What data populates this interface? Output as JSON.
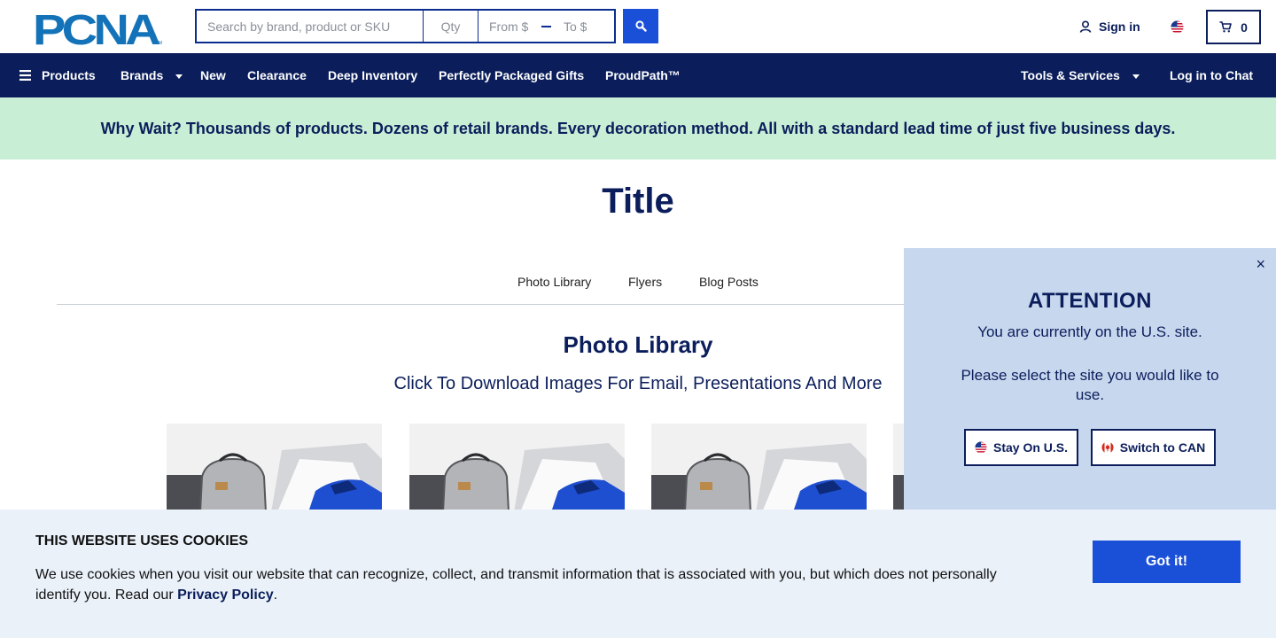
{
  "header": {
    "logo_text": "PCNA",
    "search": {
      "placeholder": "Search by brand, product or SKU",
      "value": ""
    },
    "qty": {
      "placeholder": "Qty",
      "value": ""
    },
    "price_from": {
      "placeholder": "From $",
      "value": ""
    },
    "price_to": {
      "placeholder": "To $",
      "value": ""
    },
    "signin_label": "Sign in",
    "cart_count": "0"
  },
  "nav": {
    "products": "Products",
    "brands": "Brands",
    "new": "New",
    "clearance": "Clearance",
    "deep_inventory": "Deep Inventory",
    "gifts": "Perfectly Packaged Gifts",
    "proudpath": "ProudPath™",
    "tools": "Tools & Services",
    "chat": "Log in to Chat"
  },
  "banner": {
    "text": "Why Wait? Thousands of products. Dozens of retail brands. Every decoration method. All with a standard lead time of just five business days."
  },
  "page": {
    "title": "Title"
  },
  "tabs": [
    {
      "label": "Photo Library"
    },
    {
      "label": "Flyers"
    },
    {
      "label": "Blog Posts"
    }
  ],
  "section": {
    "title": "Photo Library",
    "subtitle": "Click To Download Images For Email, Presentations And More"
  },
  "attention": {
    "title": "ATTENTION",
    "line1": "You are currently on the U.S. site.",
    "line2": "Please select the site you would like to use.",
    "stay_label": "Stay On U.S.",
    "switch_label": "Switch to CAN",
    "close": "×"
  },
  "cookie": {
    "title": "THIS WEBSITE USES COOKIES",
    "text": "We use cookies when you visit our website that can recognize, collect, and transmit information that is associated with you, but which does not personally identify you. Read our ",
    "link": "Privacy Policy",
    "end": ".",
    "button": "Got it!"
  },
  "colors": {
    "navy": "#0b1e5b",
    "accent_blue": "#1a4fd8",
    "banner_green": "#c8efd6",
    "popup_blue": "#c7d7ee",
    "cookie_bg": "#eaf1f9"
  },
  "icons": [
    "search-icon",
    "user-icon",
    "us-flag-icon",
    "cart-icon",
    "hamburger-icon",
    "close-icon",
    "canada-flag-icon"
  ]
}
